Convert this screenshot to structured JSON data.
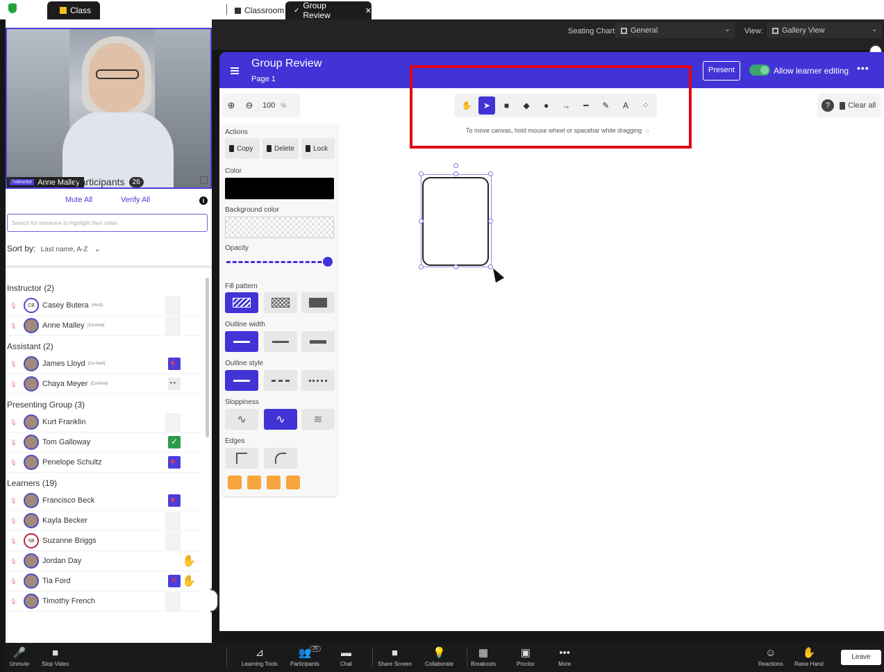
{
  "tabs": {
    "class": "Class",
    "classroom": "Classroom",
    "group_review": "Group Review"
  },
  "video": {
    "role": "Instructor",
    "name": "Anne Malley"
  },
  "participants": {
    "title": "Participants",
    "count": "26",
    "mute_all": "Mute All",
    "verify_all": "Verify All",
    "search_placeholder": "Search for someone to highlight their video",
    "sort_label": "Sort by:",
    "sort_value": "Last name, A-Z",
    "groups": [
      {
        "title": "Instructor (2)",
        "people": [
          {
            "initials": "CB",
            "name": "Casey Butera",
            "tag": "(Host)",
            "status": "blank"
          },
          {
            "initials": "",
            "name": "Anne Malley",
            "tag": "(Co-host)",
            "status": "blank"
          }
        ]
      },
      {
        "title": "Assistant (2)",
        "people": [
          {
            "initials": "",
            "name": "James Lloyd",
            "tag": "(Co-host)",
            "status": "heart"
          },
          {
            "initials": "",
            "name": "Chaya Meyer",
            "tag": "(Co-host)",
            "status": "dots"
          }
        ]
      },
      {
        "title": "Presenting Group (3)",
        "people": [
          {
            "initials": "",
            "name": "Kurt Franklin",
            "tag": "",
            "status": "blank"
          },
          {
            "initials": "",
            "name": "Tom Galloway",
            "tag": "",
            "status": "check"
          },
          {
            "initials": "",
            "name": "Penelope Schultz",
            "tag": "",
            "status": "heart"
          }
        ]
      },
      {
        "title": "Learners (19)",
        "people": [
          {
            "initials": "",
            "name": "Francisco Beck",
            "tag": "",
            "status": "heart"
          },
          {
            "initials": "",
            "name": "Kayla Becker",
            "tag": "",
            "status": "blank"
          },
          {
            "initials": "SB",
            "name": "Suzanne Briggs",
            "tag": "",
            "status": "blank"
          },
          {
            "initials": "",
            "name": "Jordan Day",
            "tag": "",
            "status": "hand"
          },
          {
            "initials": "",
            "name": "Tia Ford",
            "tag": "",
            "status": "cross-hand"
          },
          {
            "initials": "",
            "name": "Timothy French",
            "tag": "",
            "status": "blank"
          }
        ]
      }
    ]
  },
  "topbar": {
    "seating_label": "Seating Chart:",
    "seating_value": "General",
    "view_label": "View:",
    "view_value": "Gallery View"
  },
  "whiteboard": {
    "title": "Group Review",
    "page": "Page 1",
    "present": "Present",
    "allow_learner_editing": "Allow learner editing",
    "zoom": "100",
    "zoom_unit": "%",
    "hint": "To move canvas, hold mouse wheel or spacebar while dragging",
    "clear_all": "Clear all",
    "tools": [
      "hand-icon",
      "pointer-icon",
      "rectangle-icon",
      "diamond-icon",
      "ellipse-icon",
      "arrow-icon",
      "line-icon",
      "pencil-icon",
      "text-icon",
      "image-icon"
    ],
    "tool_glyphs": [
      "✋",
      "➤",
      "■",
      "◆",
      "●",
      "→",
      "━",
      "✎",
      "A",
      "⁘"
    ],
    "active_tool_index": 1,
    "props": {
      "actions_label": "Actions",
      "copy": "Copy",
      "delete": "Delete",
      "lock": "Lock",
      "color_label": "Color",
      "color_value": "#000000",
      "bg_label": "Background color",
      "opacity_label": "Opacity",
      "opacity_value": 1.0,
      "fill_label": "Fill pattern",
      "outline_width_label": "Outline width",
      "outline_style_label": "Outline style",
      "sloppiness_label": "Sloppiness",
      "edges_label": "Edges"
    }
  },
  "bottom": {
    "buttons": [
      {
        "label": "Unmute",
        "glyph": "🎤"
      },
      {
        "label": "Stop Video",
        "glyph": "■"
      },
      {
        "label": "Learning Tools",
        "glyph": "⊿"
      },
      {
        "label": "Participants",
        "glyph": "👥"
      },
      {
        "label": "Chat",
        "glyph": "▬"
      },
      {
        "label": "Share Screen",
        "glyph": "■"
      },
      {
        "label": "Collaborate",
        "glyph": "💡"
      },
      {
        "label": "Breakouts",
        "glyph": "▦"
      },
      {
        "label": "Proctor",
        "glyph": "▣"
      },
      {
        "label": "More",
        "glyph": "•••"
      },
      {
        "label": "Reactions",
        "glyph": "☺"
      },
      {
        "label": "Raise Hand",
        "glyph": "✋"
      }
    ],
    "participants_badge": "26",
    "leave": "Leave"
  },
  "colors": {
    "accent": "#4133d6",
    "highlight": "#e30613",
    "toggle_on": "#3aa56b"
  }
}
